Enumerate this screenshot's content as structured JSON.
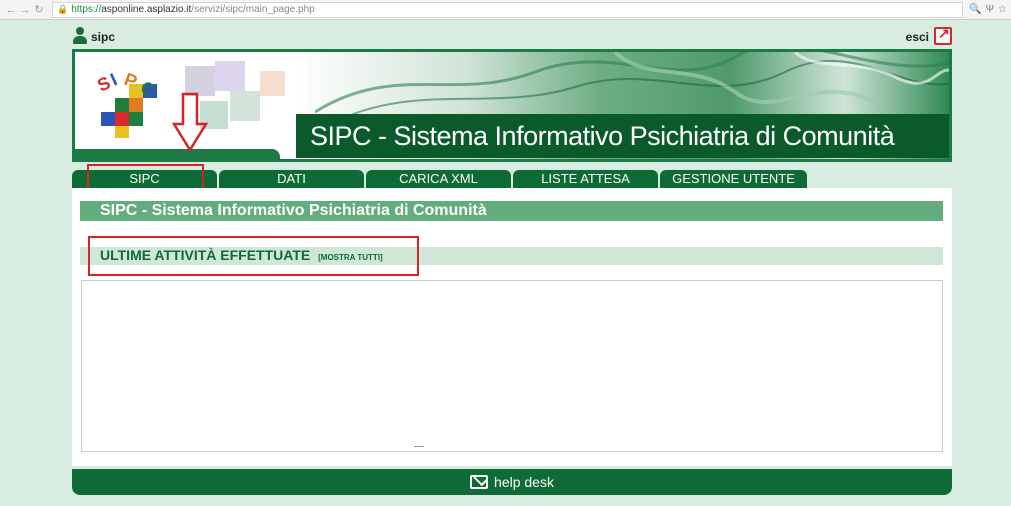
{
  "browser": {
    "url_proto": "https://",
    "url_host": "asponline.asplazio.it",
    "url_path": "/servizi/sipc/main_page.php"
  },
  "user": {
    "name": "sipc",
    "logout_label": "esci"
  },
  "banner": {
    "title": "SIPC - Sistema Informativo Psichiatria di Comunità",
    "logo_text": "SIPC"
  },
  "tabs": [
    {
      "label": "SIPC"
    },
    {
      "label": "DATI"
    },
    {
      "label": "CARICA XML"
    },
    {
      "label": "LISTE ATTESA"
    },
    {
      "label": "GESTIONE UTENTE"
    }
  ],
  "main": {
    "page_title": "SIPC - Sistema Informativo Psichiatria di Comunità",
    "section_title": "ULTIME ATTIVITÀ EFFETTUATE",
    "section_link": "[MOSTRA TUTTI]"
  },
  "footer": {
    "label": "help desk"
  },
  "colors": {
    "dark_green": "#0e6b35",
    "mid_green": "#62ac7d",
    "light_green": "#d9ece1",
    "highlight_red": "#d42424"
  }
}
